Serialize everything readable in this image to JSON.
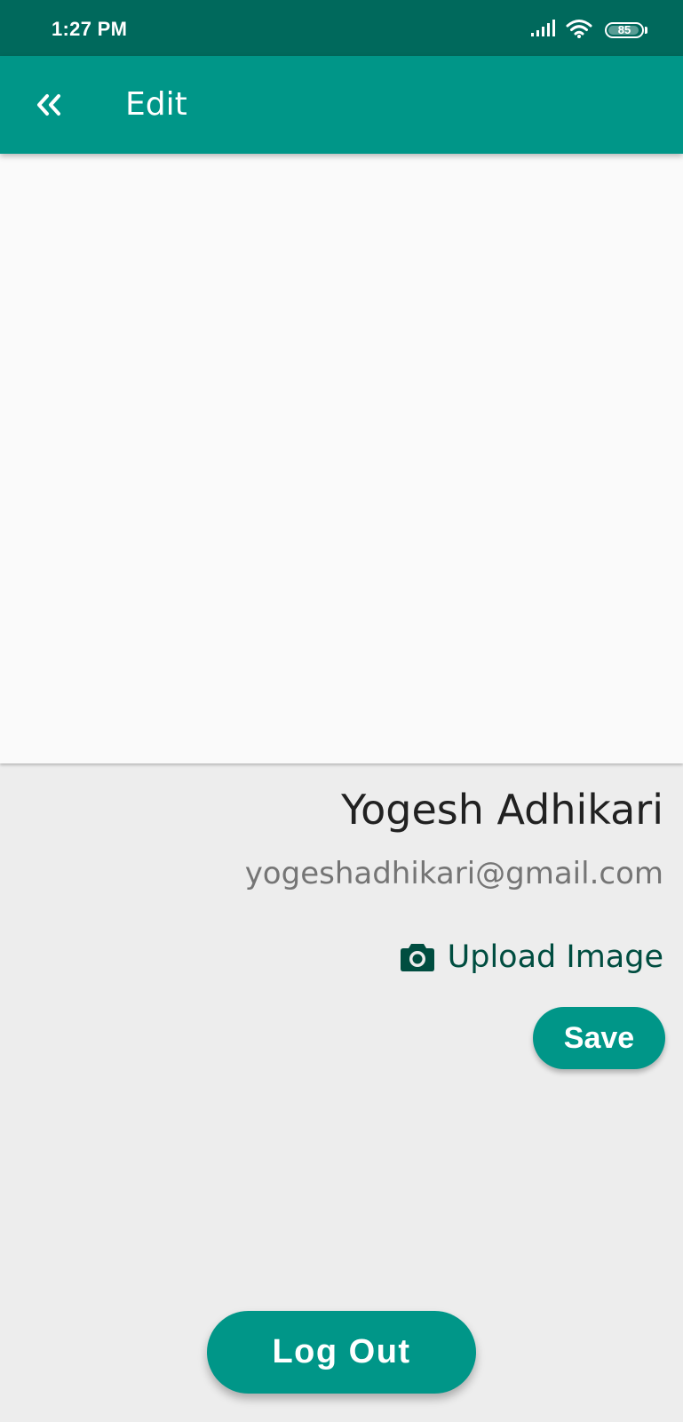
{
  "status_bar": {
    "time": "1:27 PM",
    "battery_level": "85",
    "icons": [
      "signal-icon",
      "wifi-icon",
      "battery-icon"
    ]
  },
  "app_bar": {
    "back_icon": "double-chevron-left-icon",
    "title": "Edit"
  },
  "profile": {
    "name": "Yogesh Adhikari",
    "email": "yogeshadhikari@gmail.com"
  },
  "actions": {
    "upload_icon": "camera-icon",
    "upload_label": "Upload Image",
    "save_label": "Save",
    "logout_label": "Log Out"
  },
  "colors": {
    "status_bar": "#00695c",
    "primary": "#009688",
    "upload_text": "#004d40",
    "background": "#ededed",
    "image_area": "#fafafa"
  }
}
